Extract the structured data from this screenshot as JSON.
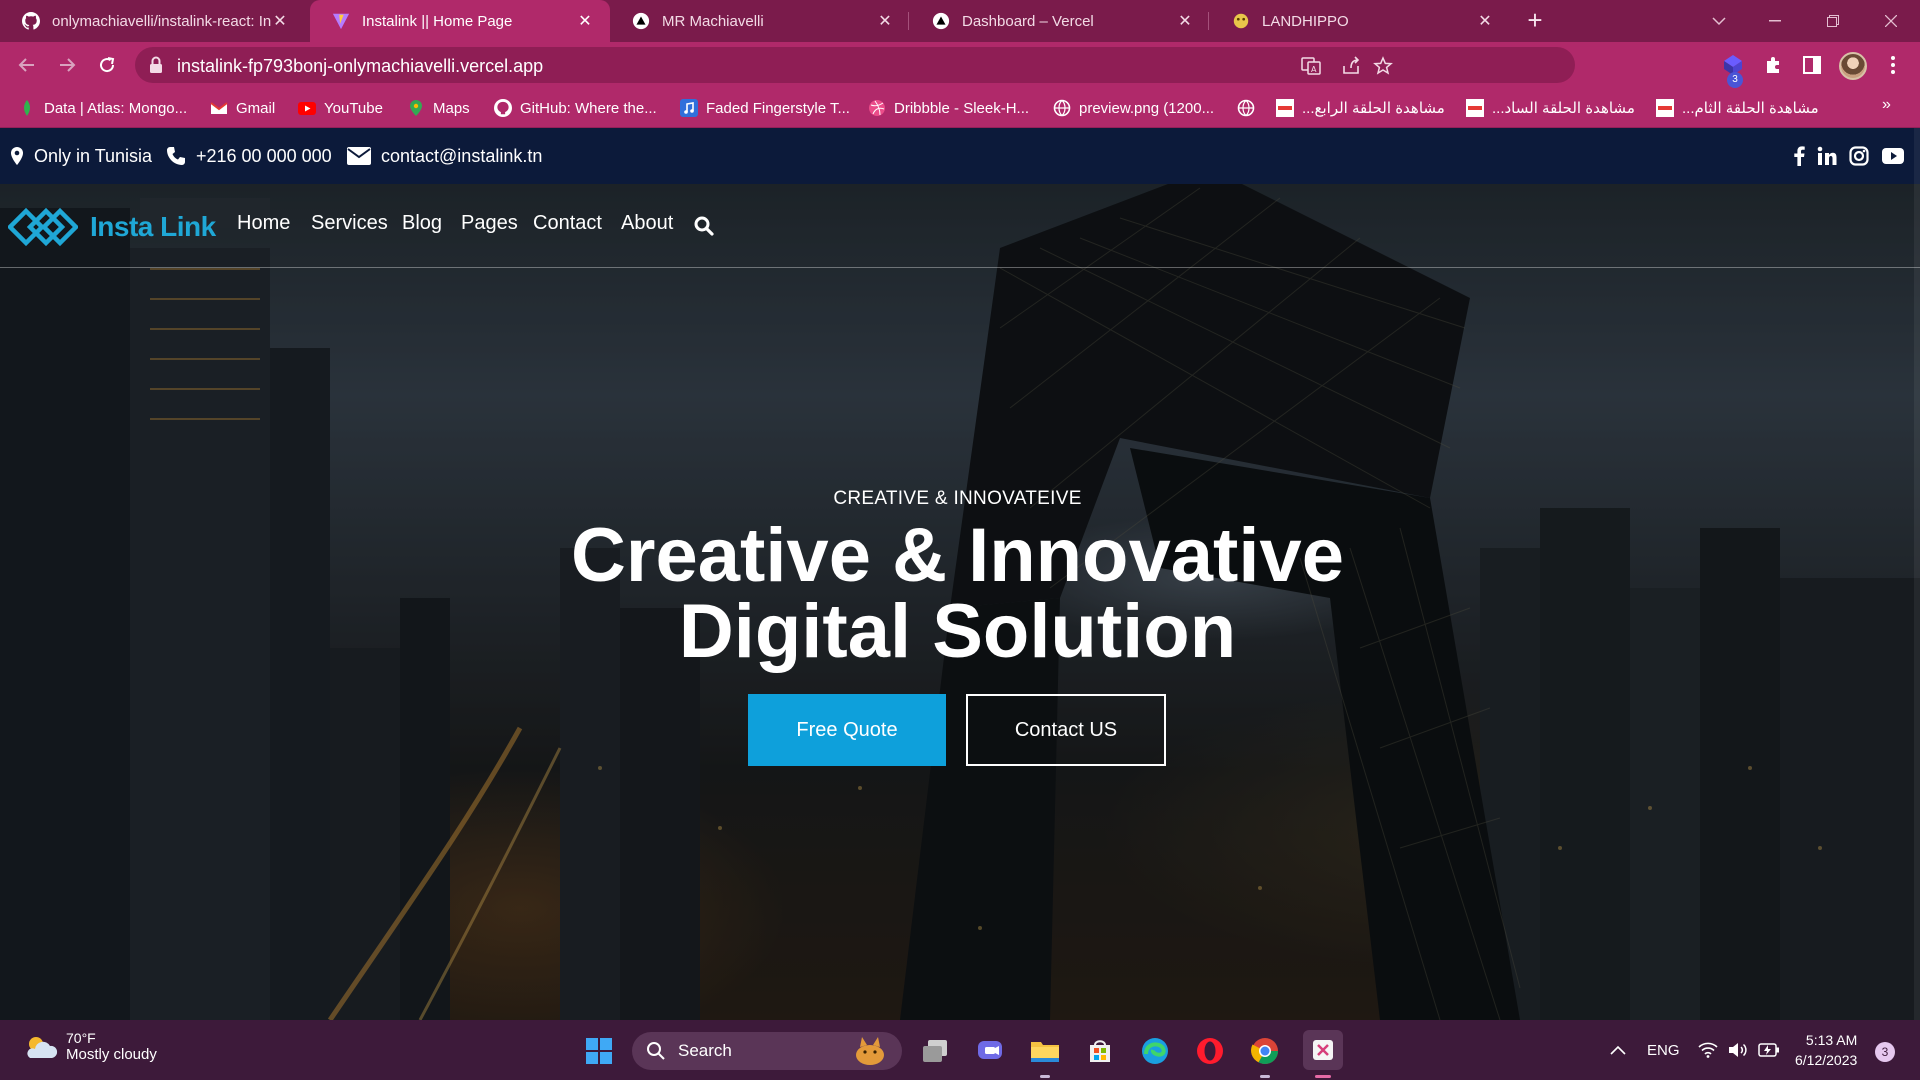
{
  "browser": {
    "tabs": [
      {
        "title": "onlymachiavelli/instalink-react: In",
        "icon": "github-icon"
      },
      {
        "title": "Instalink || Home Page",
        "icon": "vite-icon",
        "active": true
      },
      {
        "title": "MR Machiavelli",
        "icon": "vercel-icon"
      },
      {
        "title": "Dashboard – Vercel",
        "icon": "vercel-icon"
      },
      {
        "title": "LANDHIPPO",
        "icon": "hippo-icon"
      }
    ],
    "url": "instalink-fp793bonj-onlymachiavelli.vercel.app",
    "extension_badge": "3",
    "bookmarks": [
      {
        "label": "Data | Atlas: Mongo...",
        "icon": "mongodb-icon"
      },
      {
        "label": "Gmail",
        "icon": "gmail-icon"
      },
      {
        "label": "YouTube",
        "icon": "youtube-icon"
      },
      {
        "label": "Maps",
        "icon": "maps-icon"
      },
      {
        "label": "GitHub: Where the...",
        "icon": "github-icon"
      },
      {
        "label": "Faded Fingerstyle T...",
        "icon": "music-icon"
      },
      {
        "label": "Dribbble - Sleek-H...",
        "icon": "dribbble-icon"
      },
      {
        "label": "preview.png (1200...",
        "icon": "globe-icon"
      },
      {
        "label": "",
        "icon": "globe-icon"
      },
      {
        "label": "مشاهدة الحلقة الرابع...",
        "icon": "site-icon"
      },
      {
        "label": "مشاهدة الحلقة الساد...",
        "icon": "site-icon"
      },
      {
        "label": "مشاهدة الحلقة الثام...",
        "icon": "site-icon"
      }
    ]
  },
  "site": {
    "topbar": {
      "location": "Only in Tunisia",
      "phone": "+216 00 000 000",
      "email": "contact@instalink.tn",
      "socials": [
        "facebook-icon",
        "linkedin-icon",
        "instagram-icon",
        "youtube-icon"
      ]
    },
    "brand": "Insta Link",
    "nav": [
      "Home",
      "Services",
      "Blog",
      "Pages",
      "Contact",
      "About"
    ],
    "hero": {
      "eyebrow": "CREATIVE & INNOVATEIVE",
      "headline_line1": "Creative & Innovative",
      "headline_line2": "Digital Solution",
      "primary_button": "Free Quote",
      "secondary_button": "Contact US"
    },
    "colors": {
      "accent": "#0ea0db",
      "topbar": "#0c1a3a",
      "brand": "#1fa7d6"
    }
  },
  "taskbar": {
    "weather_temp": "70°F",
    "weather_condition": "Mostly cloudy",
    "search_label": "Search",
    "language": "ENG",
    "time": "5:13 AM",
    "date": "6/12/2023",
    "notification_count": "3"
  }
}
